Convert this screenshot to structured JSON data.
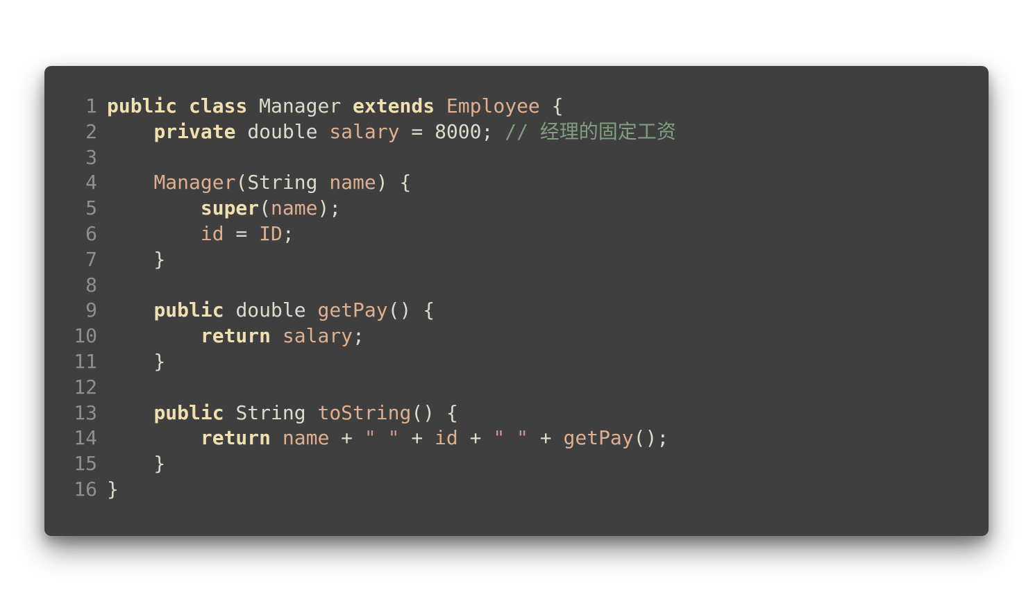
{
  "language": "java",
  "colors": {
    "background": "#3f3f3f",
    "text": "#dcdccc",
    "keyword": "#f0dfaf",
    "identifier": "#dfaf8f",
    "string": "#cc9393",
    "comment": "#7f9f7f",
    "line_number": "#8f8f8f"
  },
  "lines": [
    {
      "number": "1",
      "tokens": [
        {
          "t": "public",
          "k": "kw"
        },
        {
          "t": " ",
          "k": "pl"
        },
        {
          "t": "class",
          "k": "kw"
        },
        {
          "t": " ",
          "k": "pl"
        },
        {
          "t": "Manager",
          "k": "ty"
        },
        {
          "t": " ",
          "k": "pl"
        },
        {
          "t": "extends",
          "k": "kw"
        },
        {
          "t": " ",
          "k": "pl"
        },
        {
          "t": "Employee",
          "k": "nm"
        },
        {
          "t": " {",
          "k": "pl"
        }
      ]
    },
    {
      "number": "2",
      "tokens": [
        {
          "t": "    ",
          "k": "pl"
        },
        {
          "t": "private",
          "k": "kw"
        },
        {
          "t": " ",
          "k": "pl"
        },
        {
          "t": "double",
          "k": "ty"
        },
        {
          "t": " ",
          "k": "pl"
        },
        {
          "t": "salary",
          "k": "nm"
        },
        {
          "t": " = ",
          "k": "pl"
        },
        {
          "t": "8000",
          "k": "num"
        },
        {
          "t": "; ",
          "k": "pl"
        },
        {
          "t": "// 经理的固定工资",
          "k": "cm"
        }
      ]
    },
    {
      "number": "3",
      "tokens": []
    },
    {
      "number": "4",
      "tokens": [
        {
          "t": "    ",
          "k": "pl"
        },
        {
          "t": "Manager",
          "k": "fn"
        },
        {
          "t": "(",
          "k": "pl"
        },
        {
          "t": "String",
          "k": "ty"
        },
        {
          "t": " ",
          "k": "pl"
        },
        {
          "t": "name",
          "k": "nm"
        },
        {
          "t": ") {",
          "k": "pl"
        }
      ]
    },
    {
      "number": "5",
      "tokens": [
        {
          "t": "        ",
          "k": "pl"
        },
        {
          "t": "super",
          "k": "kw"
        },
        {
          "t": "(",
          "k": "pl"
        },
        {
          "t": "name",
          "k": "nm"
        },
        {
          "t": ");",
          "k": "pl"
        }
      ]
    },
    {
      "number": "6",
      "tokens": [
        {
          "t": "        ",
          "k": "pl"
        },
        {
          "t": "id",
          "k": "nm"
        },
        {
          "t": " = ",
          "k": "pl"
        },
        {
          "t": "ID",
          "k": "nm"
        },
        {
          "t": ";",
          "k": "pl"
        }
      ]
    },
    {
      "number": "7",
      "tokens": [
        {
          "t": "    }",
          "k": "pl"
        }
      ]
    },
    {
      "number": "8",
      "tokens": []
    },
    {
      "number": "9",
      "tokens": [
        {
          "t": "    ",
          "k": "pl"
        },
        {
          "t": "public",
          "k": "kw"
        },
        {
          "t": " ",
          "k": "pl"
        },
        {
          "t": "double",
          "k": "ty"
        },
        {
          "t": " ",
          "k": "pl"
        },
        {
          "t": "getPay",
          "k": "fn"
        },
        {
          "t": "() {",
          "k": "pl"
        }
      ]
    },
    {
      "number": "10",
      "tokens": [
        {
          "t": "        ",
          "k": "pl"
        },
        {
          "t": "return",
          "k": "kw"
        },
        {
          "t": " ",
          "k": "pl"
        },
        {
          "t": "salary",
          "k": "nm"
        },
        {
          "t": ";",
          "k": "pl"
        }
      ]
    },
    {
      "number": "11",
      "tokens": [
        {
          "t": "    }",
          "k": "pl"
        }
      ]
    },
    {
      "number": "12",
      "tokens": []
    },
    {
      "number": "13",
      "tokens": [
        {
          "t": "    ",
          "k": "pl"
        },
        {
          "t": "public",
          "k": "kw"
        },
        {
          "t": " ",
          "k": "pl"
        },
        {
          "t": "String",
          "k": "ty"
        },
        {
          "t": " ",
          "k": "pl"
        },
        {
          "t": "toString",
          "k": "fn"
        },
        {
          "t": "() {",
          "k": "pl"
        }
      ]
    },
    {
      "number": "14",
      "tokens": [
        {
          "t": "        ",
          "k": "pl"
        },
        {
          "t": "return",
          "k": "kw"
        },
        {
          "t": " ",
          "k": "pl"
        },
        {
          "t": "name",
          "k": "nm"
        },
        {
          "t": " + ",
          "k": "pl"
        },
        {
          "t": "\" \"",
          "k": "str"
        },
        {
          "t": " + ",
          "k": "pl"
        },
        {
          "t": "id",
          "k": "nm"
        },
        {
          "t": " + ",
          "k": "pl"
        },
        {
          "t": "\" \"",
          "k": "str"
        },
        {
          "t": " + ",
          "k": "pl"
        },
        {
          "t": "getPay",
          "k": "fn"
        },
        {
          "t": "();",
          "k": "pl"
        }
      ]
    },
    {
      "number": "15",
      "tokens": [
        {
          "t": "    }",
          "k": "pl"
        }
      ]
    },
    {
      "number": "16",
      "tokens": [
        {
          "t": "}",
          "k": "pl"
        }
      ]
    }
  ]
}
